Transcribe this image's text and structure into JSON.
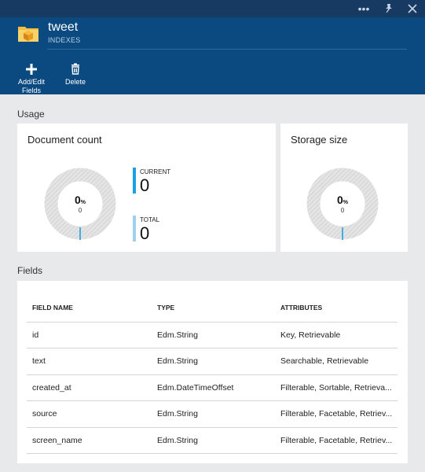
{
  "window": {
    "more_icon": "ellipsis-icon",
    "pin_icon": "pin-icon",
    "close_icon": "close-icon"
  },
  "header": {
    "title": "tweet",
    "subtitle": "INDEXES",
    "icon": "folder-cube-icon"
  },
  "commands": [
    {
      "label_line1": "Add/Edit",
      "label_line2": "Fields",
      "icon": "plus-icon"
    },
    {
      "label_line1": "Delete",
      "label_line2": "",
      "icon": "trash-icon"
    }
  ],
  "usage": {
    "section_title": "Usage",
    "document_count": {
      "title": "Document count",
      "percent": "0",
      "percent_unit": "%",
      "value": "0",
      "current_label": "CURRENT",
      "current_value": "0",
      "total_label": "TOTAL",
      "total_value": "0"
    },
    "storage_size": {
      "title": "Storage size",
      "percent": "0",
      "percent_unit": "%",
      "value": "0"
    }
  },
  "fields": {
    "section_title": "Fields",
    "columns": [
      "FIELD NAME",
      "TYPE",
      "ATTRIBUTES"
    ],
    "rows": [
      {
        "name": "id",
        "type": "Edm.String",
        "attributes": "Key, Retrievable"
      },
      {
        "name": "text",
        "type": "Edm.String",
        "attributes": "Searchable, Retrievable"
      },
      {
        "name": "created_at",
        "type": "Edm.DateTimeOffset",
        "attributes": "Filterable, Sortable, Retrieva..."
      },
      {
        "name": "source",
        "type": "Edm.String",
        "attributes": "Filterable, Facetable, Retriev..."
      },
      {
        "name": "screen_name",
        "type": "Edm.String",
        "attributes": "Filterable, Facetable, Retriev..."
      }
    ]
  },
  "colors": {
    "topbar": "#173a63",
    "header": "#0b4a80",
    "current_accent": "#1ba1e2",
    "total_accent": "#9fd0ef",
    "donut_track": "#dcdcdc"
  }
}
